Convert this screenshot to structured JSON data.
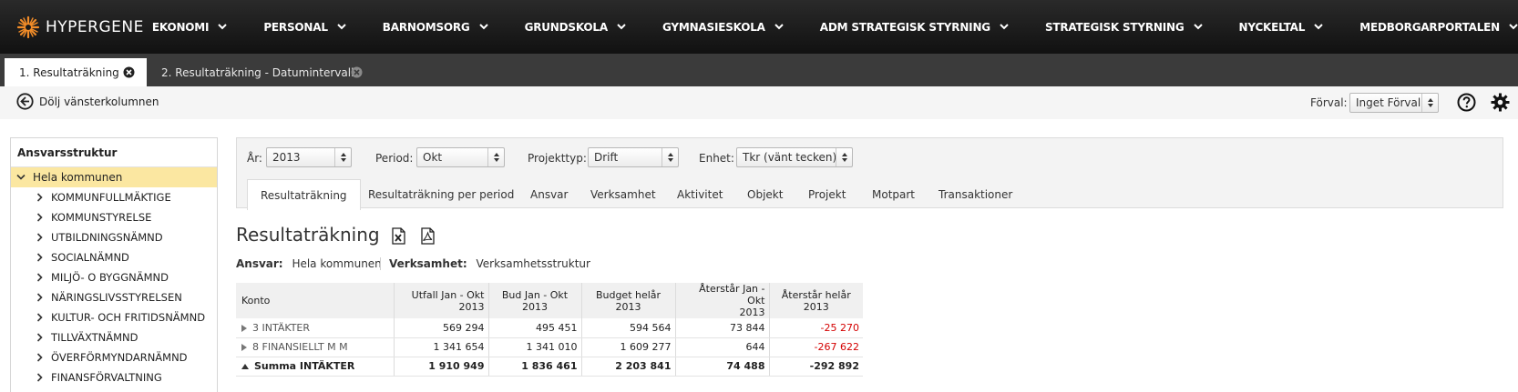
{
  "brand": {
    "name": "HYPERGENE",
    "color": "#f28c28"
  },
  "nav": [
    "EKONOMI",
    "PERSONAL",
    "BARNOMSORG",
    "GRUNDSKOLA",
    "GYMNASIESKOLA",
    "ADM STRATEGISK STYRNING",
    "STRATEGISK STYRNING",
    "NYCKELTAL",
    "MEDBORGARPORTALEN"
  ],
  "doc_tabs": [
    {
      "label": "1. Resultaträkning",
      "active": true
    },
    {
      "label": "2. Resultaträkning - Datumintervall",
      "active": false
    }
  ],
  "toolbar": {
    "hide_left": "Dölj vänsterkolumnen",
    "forval_label": "Förval:",
    "forval_value": "Inget Förval",
    "help_icon": "help-icon",
    "settings_icon": "gear-icon"
  },
  "tree": {
    "title": "Ansvarsstruktur",
    "root": "Hela kommunen",
    "items": [
      "KOMMUNFULLMÄKTIGE",
      "KOMMUNSTYRELSE",
      "UTBILDNINGSNÄMND",
      "SOCIALNÄMND",
      "MILJÖ- O BYGGNÄMND",
      "NÄRINGSLIVSSTYRELSEN",
      "KULTUR- OCH FRITIDSNÄMND",
      "TILLVÄXTNÄMND",
      "ÖVERFÖRMYNDARNÄMND",
      "FINANSFÖRVALTNING"
    ]
  },
  "filters": {
    "year": {
      "label": "År:",
      "value": "2013"
    },
    "period": {
      "label": "Period:",
      "value": "Okt"
    },
    "projtype": {
      "label": "Projekttyp:",
      "value": "Drift"
    },
    "unit": {
      "label": "Enhet:",
      "value": "Tkr (vänt tecken)"
    }
  },
  "panel_tabs": [
    "Resultaträkning",
    "Resultaträkning per period",
    "Ansvar",
    "Verksamhet",
    "Aktivitet",
    "Objekt",
    "Projekt",
    "Motpart",
    "Transaktioner"
  ],
  "report": {
    "title": "Resultaträkning",
    "ansvar_label": "Ansvar:",
    "ansvar_value": "Hela kommunen",
    "verks_label": "Verksamhet:",
    "verks_value": "Verksamhetsstruktur"
  },
  "table": {
    "headers": {
      "konto": "Konto",
      "c1a": "Utfall Jan - Okt",
      "c1b": "2013",
      "c2": "Bud Jan - Okt 2013",
      "c3": "Budget helår 2013",
      "c4a": "Återstår Jan - Okt",
      "c4b": "2013",
      "c5": "Återstår helår 2013"
    },
    "rows": [
      {
        "konto": "3 INTÄKTER",
        "v1": "569 294",
        "v2": "495 451",
        "v3": "594 564",
        "v4": "73 844",
        "v5": "-25 270"
      },
      {
        "konto": "8 FINANSIELLT M M",
        "v1": "1 341 654",
        "v2": "1 341 010",
        "v3": "1 609 277",
        "v4": "644",
        "v5": "-267 622"
      },
      {
        "konto": "Summa INTÄKTER",
        "v1": "1 910 949",
        "v2": "1 836 461",
        "v3": "2 203 841",
        "v4": "74 488",
        "v5": "-292 892"
      }
    ]
  },
  "colors": {
    "negative": "#d40000",
    "selected_tree": "#fbe7a1",
    "topbar": "#1a1a1a"
  }
}
